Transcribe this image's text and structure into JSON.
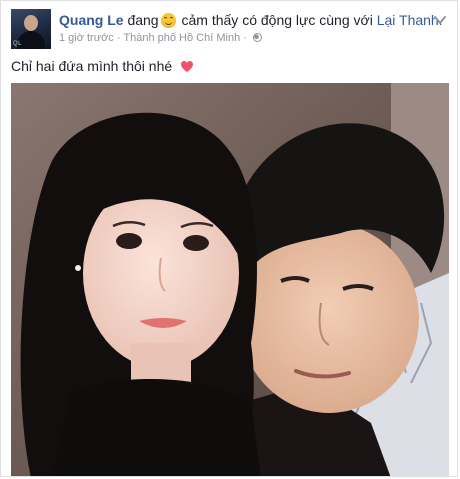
{
  "post": {
    "author": "Quang Le",
    "verb": "đang",
    "feeling": "cảm thấy có động lực cùng với",
    "tagged_person": "Lại Thanh.",
    "time": "1 giờ trước",
    "separator": "·",
    "location": "Thành phố Hồ Chí Minh",
    "separator2": "·",
    "message": "Chỉ hai đứa mình thôi nhé",
    "avatar_tag": "QL",
    "icons": {
      "feeling": "smiley-emoji-icon",
      "audience": "globe-icon",
      "menu": "chevron-down-icon",
      "heart": "heart-icon"
    },
    "colors": {
      "link": "#365899",
      "meta": "#90949c",
      "heart": "#f25268"
    }
  }
}
